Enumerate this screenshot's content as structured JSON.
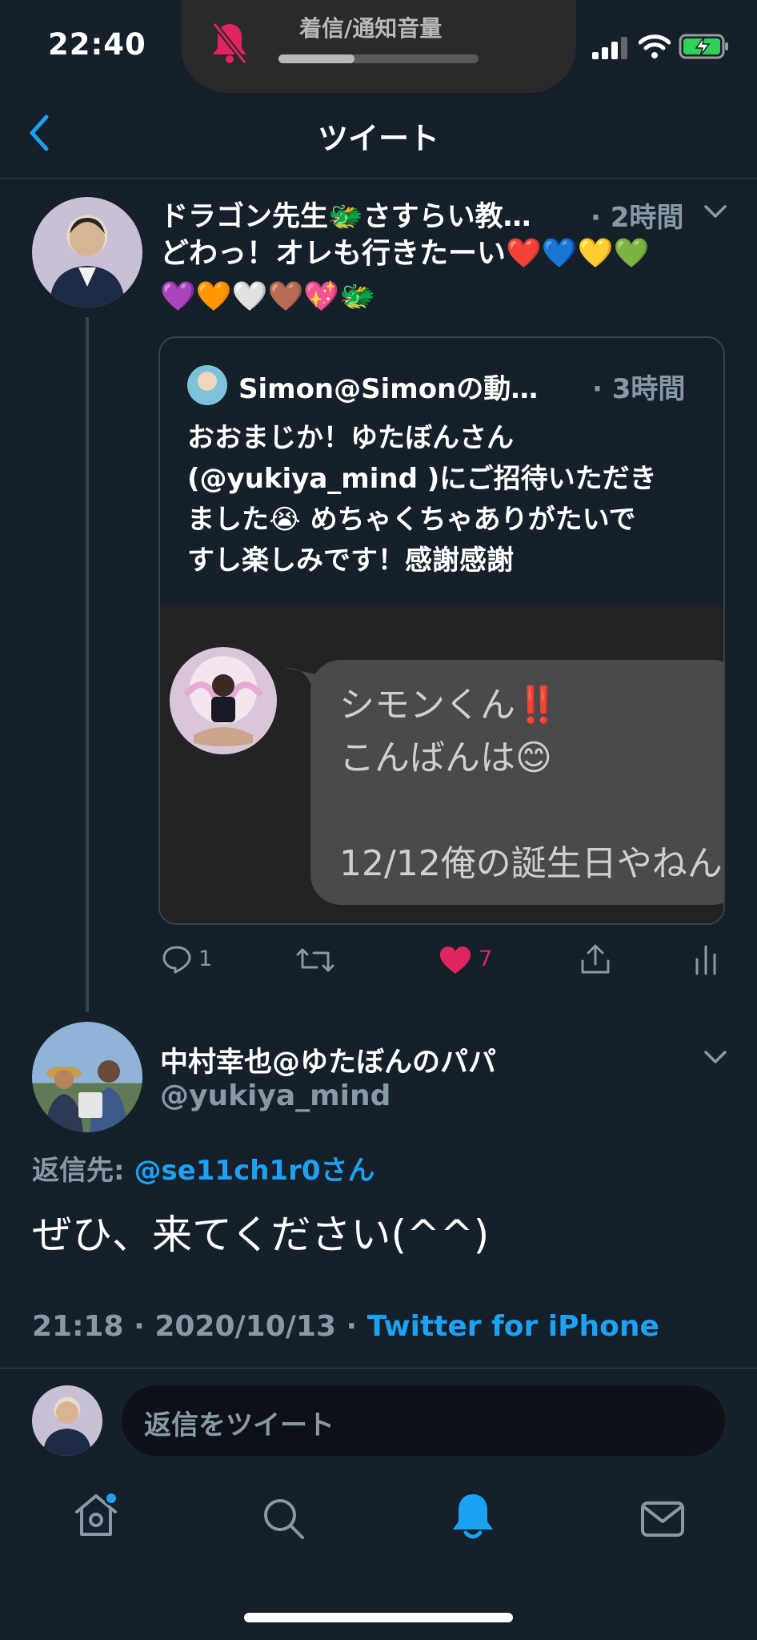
{
  "status_bar": {
    "time": "22:40",
    "volume_label": "着信/通知音量",
    "volume_level": 0.38
  },
  "header": {
    "title": "ツイート"
  },
  "parent_tweet": {
    "author_name": "ドラゴン先生🐲さすらい教…",
    "time_ago": "· 2時間",
    "text_line1": "どわっ！オレも行きたーい❤️💙💛💚",
    "text_line2": "💜🧡🤍🤎💖🐲",
    "quoted": {
      "author": "Simon@Simonの動…",
      "time_ago": "· 3時間",
      "text_lines": [
        "おおまじか！ゆたぼんさん",
        "(@yukiya_mind )にご招待いただき",
        "ました😭 めちゃくちゃありがたいで",
        "すし楽しみです！感謝感謝"
      ],
      "image_text": {
        "line1": "シモンくん‼️",
        "line2": "こんばんは😊",
        "line3": "12/12俺の誕生日やねん"
      }
    },
    "actions": {
      "reply_count": "1",
      "like_count": "7"
    }
  },
  "main_tweet": {
    "author_name": "中村幸也@ゆたぼんのパパ",
    "handle": "@yukiya_mind",
    "reply_to_label": "返信先:",
    "reply_to_handle": "@se11ch1r0さん",
    "text": "ぜひ、来てください(^^)",
    "time": "21:18 · 2020/10/13 · ",
    "source": "Twitter for iPhone"
  },
  "reply_box": {
    "placeholder": "返信をツイート"
  },
  "colors": {
    "background": "#15202b",
    "accent_blue": "#1da1f2",
    "like_red": "#e0245e",
    "muted": "#8899a6"
  },
  "tab_bar": {
    "items": [
      "home-icon",
      "search-icon",
      "notifications-icon",
      "messages-icon"
    ],
    "active": "notifications-icon"
  }
}
